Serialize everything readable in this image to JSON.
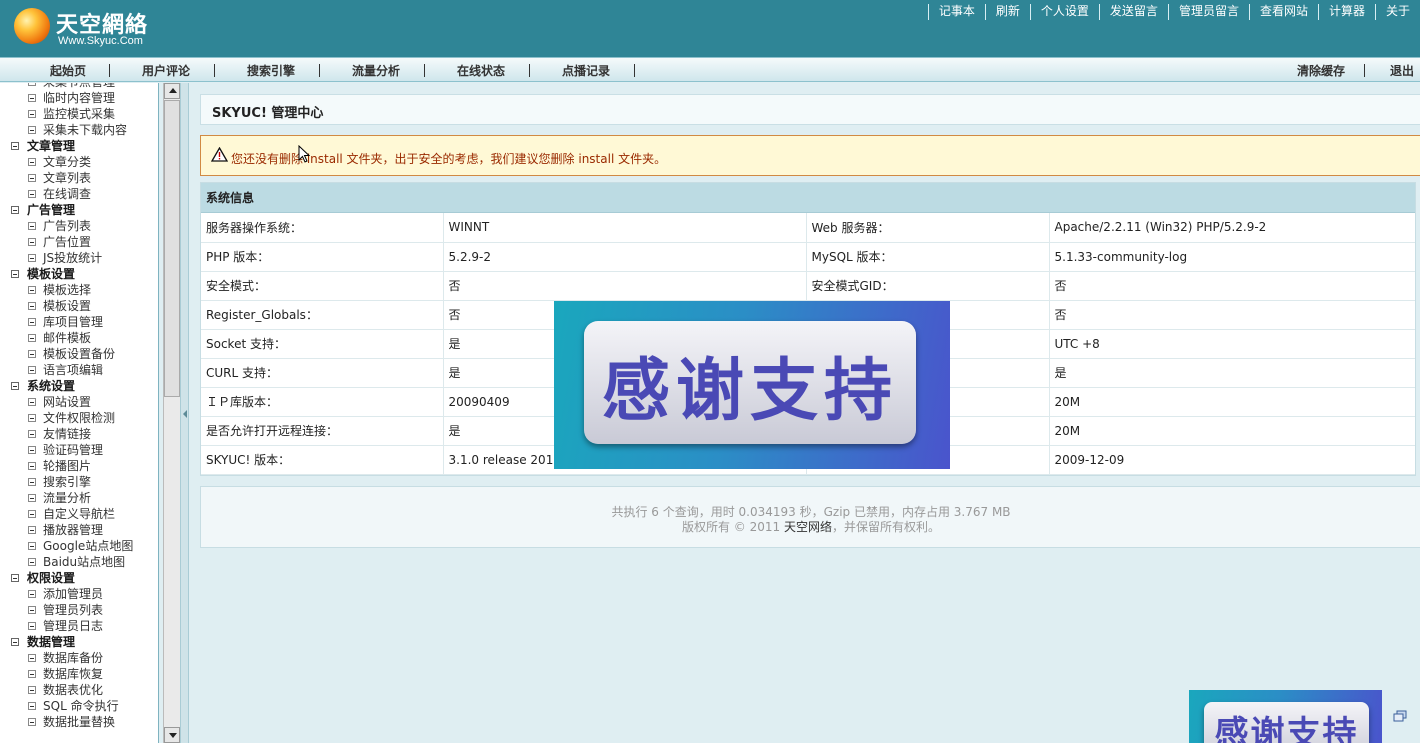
{
  "header": {
    "logo_cn": "天空網絡",
    "logo_en": "Www.Skyuc.Com",
    "toplinks": [
      "记事本",
      "刷新",
      "个人设置",
      "发送留言",
      "管理员留言",
      "查看网站",
      "计算器",
      "关于"
    ]
  },
  "nav": {
    "items": [
      "起始页",
      "用户评论",
      "搜索引擎",
      "流量分析",
      "在线状态",
      "点播记录"
    ],
    "clear_cache": "清除缓存",
    "logout": "退出"
  },
  "sidebar": {
    "rows": [
      {
        "type": "leaf",
        "label": "采集节点管理"
      },
      {
        "type": "leaf",
        "label": "临时内容管理"
      },
      {
        "type": "leaf",
        "label": "监控模式采集"
      },
      {
        "type": "leaf",
        "label": "采集未下载内容"
      },
      {
        "type": "group",
        "label": "文章管理"
      },
      {
        "type": "leaf",
        "label": "文章分类"
      },
      {
        "type": "leaf",
        "label": "文章列表"
      },
      {
        "type": "leaf",
        "label": "在线调查"
      },
      {
        "type": "group",
        "label": "广告管理"
      },
      {
        "type": "leaf",
        "label": "广告列表"
      },
      {
        "type": "leaf",
        "label": "广告位置"
      },
      {
        "type": "leaf",
        "label": "JS投放统计"
      },
      {
        "type": "group",
        "label": "模板设置"
      },
      {
        "type": "leaf",
        "label": "模板选择"
      },
      {
        "type": "leaf",
        "label": "模板设置"
      },
      {
        "type": "leaf",
        "label": "库项目管理"
      },
      {
        "type": "leaf",
        "label": "邮件模板"
      },
      {
        "type": "leaf",
        "label": "模板设置备份"
      },
      {
        "type": "leaf",
        "label": "语言项编辑"
      },
      {
        "type": "group",
        "label": "系统设置"
      },
      {
        "type": "leaf",
        "label": "网站设置"
      },
      {
        "type": "leaf",
        "label": "文件权限检测"
      },
      {
        "type": "leaf",
        "label": "友情链接"
      },
      {
        "type": "leaf",
        "label": "验证码管理"
      },
      {
        "type": "leaf",
        "label": "轮播图片"
      },
      {
        "type": "leaf",
        "label": "搜索引擎"
      },
      {
        "type": "leaf",
        "label": "流量分析"
      },
      {
        "type": "leaf",
        "label": "自定义导航栏"
      },
      {
        "type": "leaf",
        "label": "播放器管理"
      },
      {
        "type": "leaf",
        "label": "Google站点地图"
      },
      {
        "type": "leaf",
        "label": "Baidu站点地图"
      },
      {
        "type": "group",
        "label": "权限设置"
      },
      {
        "type": "leaf",
        "label": "添加管理员"
      },
      {
        "type": "leaf",
        "label": "管理员列表"
      },
      {
        "type": "leaf",
        "label": "管理员日志"
      },
      {
        "type": "group",
        "label": "数据管理"
      },
      {
        "type": "leaf",
        "label": "数据库备份"
      },
      {
        "type": "leaf",
        "label": "数据库恢复"
      },
      {
        "type": "leaf",
        "label": "数据表优化"
      },
      {
        "type": "leaf",
        "label": "SQL 命令执行"
      },
      {
        "type": "leaf",
        "label": "数据批量替换"
      }
    ]
  },
  "main": {
    "title": "SKYUC! 管理中心",
    "warning": "您还没有删除 install 文件夹，出于安全的考虑，我们建议您删除 install 文件夹。",
    "sysinfo_title": "系统信息",
    "rows": [
      [
        "服务器操作系统：",
        "WINNT",
        "Web 服务器：",
        "Apache/2.2.11 (Win32) PHP/5.2.9-2"
      ],
      [
        "PHP 版本：",
        "5.2.9-2",
        "MySQL 版本：",
        "5.1.33-community-log"
      ],
      [
        "安全模式：",
        "否",
        "安全模式GID：",
        "否"
      ],
      [
        "Register_Globals：",
        "否",
        "",
        "否"
      ],
      [
        "Socket 支持：",
        "是",
        "",
        "UTC +8"
      ],
      [
        "CURL 支持：",
        "是",
        "",
        "是"
      ],
      [
        "ＩＰ库版本：",
        "20090409",
        "",
        "20M"
      ],
      [
        "是否允许打开远程连接：",
        "是",
        "",
        "20M"
      ],
      [
        "SKYUC! 版本：",
        "3.1.0 release 2010",
        "",
        "2009-12-09"
      ]
    ],
    "footer_line1": "共执行 6 个查询，用时 0.034193 秒，Gzip 已禁用，内存占用 3.767 MB",
    "footer_prefix": "版权所有 © 2011 ",
    "footer_brand": "天空网络",
    "footer_suffix": "，并保留所有权利。"
  },
  "overlay": {
    "banner_text": "感谢支持"
  },
  "colors": {
    "header_bg": "#2f8596",
    "warning_text": "#9a2a00",
    "banner_text": "#4a49b5"
  }
}
